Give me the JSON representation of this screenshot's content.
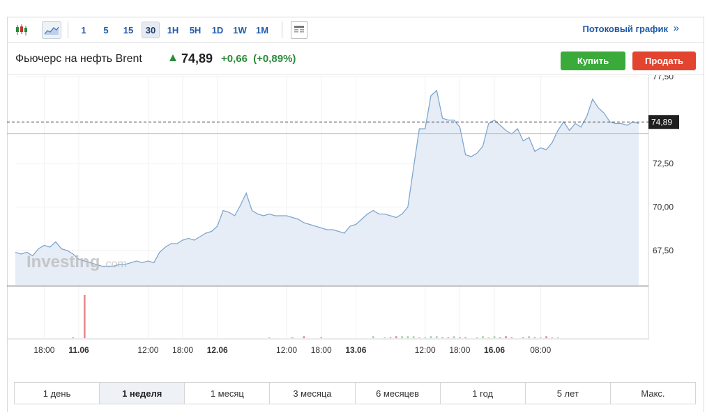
{
  "toolbar": {
    "icons": [
      "candlestick-icon",
      "area-chart-icon",
      "news-layout-icon"
    ],
    "intervals": [
      {
        "label": "1",
        "active": false
      },
      {
        "label": "5",
        "active": false
      },
      {
        "label": "15",
        "active": false
      },
      {
        "label": "30",
        "active": true
      },
      {
        "label": "1H",
        "active": false
      },
      {
        "label": "5H",
        "active": false
      },
      {
        "label": "1D",
        "active": false
      },
      {
        "label": "1W",
        "active": false
      },
      {
        "label": "1M",
        "active": false
      }
    ],
    "stream_link": "Потоковый график",
    "stream_arrow": "»"
  },
  "header": {
    "instrument": "Фьючерс на нефть Brent",
    "price": "74,89",
    "change": "+0,66",
    "change_pct": "(+0,89%)",
    "buy_label": "Купить",
    "sell_label": "Продать"
  },
  "colors": {
    "accent": "#1e5aa8",
    "up": "#2c8a3a",
    "buy": "#3aaa3a",
    "sell": "#e2442f",
    "line": "#7ea6cf",
    "area": "#e6edf6",
    "vol_up": "#9fd4a6",
    "vol_down": "#e58a8a"
  },
  "watermark": {
    "brand": "Investing",
    "suffix": ".com"
  },
  "chart_data": {
    "type": "area",
    "ylim": [
      65.5,
      77.5
    ],
    "y_ticks": [
      "77,50",
      "72,50",
      "70,00",
      "67,50"
    ],
    "y_tick_values": [
      77.5,
      72.5,
      70.0,
      67.5
    ],
    "last_price": 74.89,
    "last_price_label": "74,89",
    "prev_close": 74.23,
    "x_ticks": [
      "18:00",
      "11.06",
      "12:00",
      "18:00",
      "12.06",
      "12:00",
      "18:00",
      "13.06",
      "12:00",
      "18:00",
      "16.06",
      "08:00"
    ],
    "x_tick_index": [
      5,
      11,
      23,
      29,
      35,
      47,
      53,
      59,
      71,
      77,
      83,
      91
    ],
    "bold_ticks": [
      "11.06",
      "12.06",
      "13.06",
      "16.06"
    ],
    "values": [
      67.4,
      67.3,
      67.4,
      67.2,
      67.6,
      67.8,
      67.7,
      68.0,
      67.6,
      67.5,
      67.3,
      67.0,
      66.9,
      66.8,
      66.7,
      66.6,
      66.6,
      66.6,
      66.7,
      66.7,
      66.8,
      66.9,
      66.8,
      66.9,
      66.8,
      67.4,
      67.7,
      67.9,
      67.9,
      68.1,
      68.2,
      68.1,
      68.3,
      68.5,
      68.6,
      68.9,
      69.8,
      69.7,
      69.5,
      70.1,
      70.8,
      69.8,
      69.6,
      69.5,
      69.6,
      69.5,
      69.5,
      69.5,
      69.4,
      69.3,
      69.1,
      69.0,
      68.9,
      68.8,
      68.7,
      68.7,
      68.6,
      68.5,
      68.9,
      69.0,
      69.3,
      69.6,
      69.8,
      69.6,
      69.6,
      69.5,
      69.4,
      69.6,
      70.0,
      72.3,
      74.5,
      74.5,
      76.4,
      76.7,
      75.1,
      75.0,
      75.0,
      74.6,
      73.0,
      72.9,
      73.1,
      73.5,
      74.8,
      75.0,
      74.7,
      74.4,
      74.2,
      74.5,
      73.8,
      74.0,
      73.2,
      73.4,
      73.3,
      73.7,
      74.4,
      74.9,
      74.4,
      74.8,
      74.6,
      75.2,
      76.2,
      75.7,
      75.4,
      74.9,
      74.8,
      74.8,
      74.7,
      74.9,
      74.8
    ],
    "volumes": [
      0,
      0,
      0,
      0,
      0,
      0,
      0,
      0,
      0,
      0,
      1,
      0,
      44,
      0,
      0,
      0,
      0,
      0,
      0,
      0,
      0,
      0,
      0,
      0,
      0,
      0,
      0,
      0,
      0,
      0,
      0,
      0,
      0,
      0,
      0,
      0,
      0,
      0,
      0,
      0,
      0,
      0,
      0,
      0,
      1,
      0,
      0,
      0,
      1,
      0,
      2,
      0,
      0,
      1,
      0,
      0,
      0,
      0,
      0,
      0,
      0,
      0,
      2,
      0,
      1,
      1,
      2,
      2,
      2,
      2,
      1,
      1,
      2,
      2,
      1,
      1,
      2,
      1,
      1,
      0,
      1,
      2,
      1,
      2,
      1,
      2,
      1,
      0,
      1,
      2,
      1,
      1,
      2,
      1,
      1,
      0,
      0,
      0,
      0,
      0,
      0,
      0,
      0,
      0,
      0,
      0,
      0,
      0,
      0
    ]
  },
  "ranges": [
    {
      "label": "1 день",
      "active": false
    },
    {
      "label": "1 неделя",
      "active": true
    },
    {
      "label": "1 месяц",
      "active": false
    },
    {
      "label": "3 месяца",
      "active": false
    },
    {
      "label": "6 месяцев",
      "active": false
    },
    {
      "label": "1 год",
      "active": false
    },
    {
      "label": "5 лет",
      "active": false
    },
    {
      "label": "Макс.",
      "active": false
    }
  ]
}
